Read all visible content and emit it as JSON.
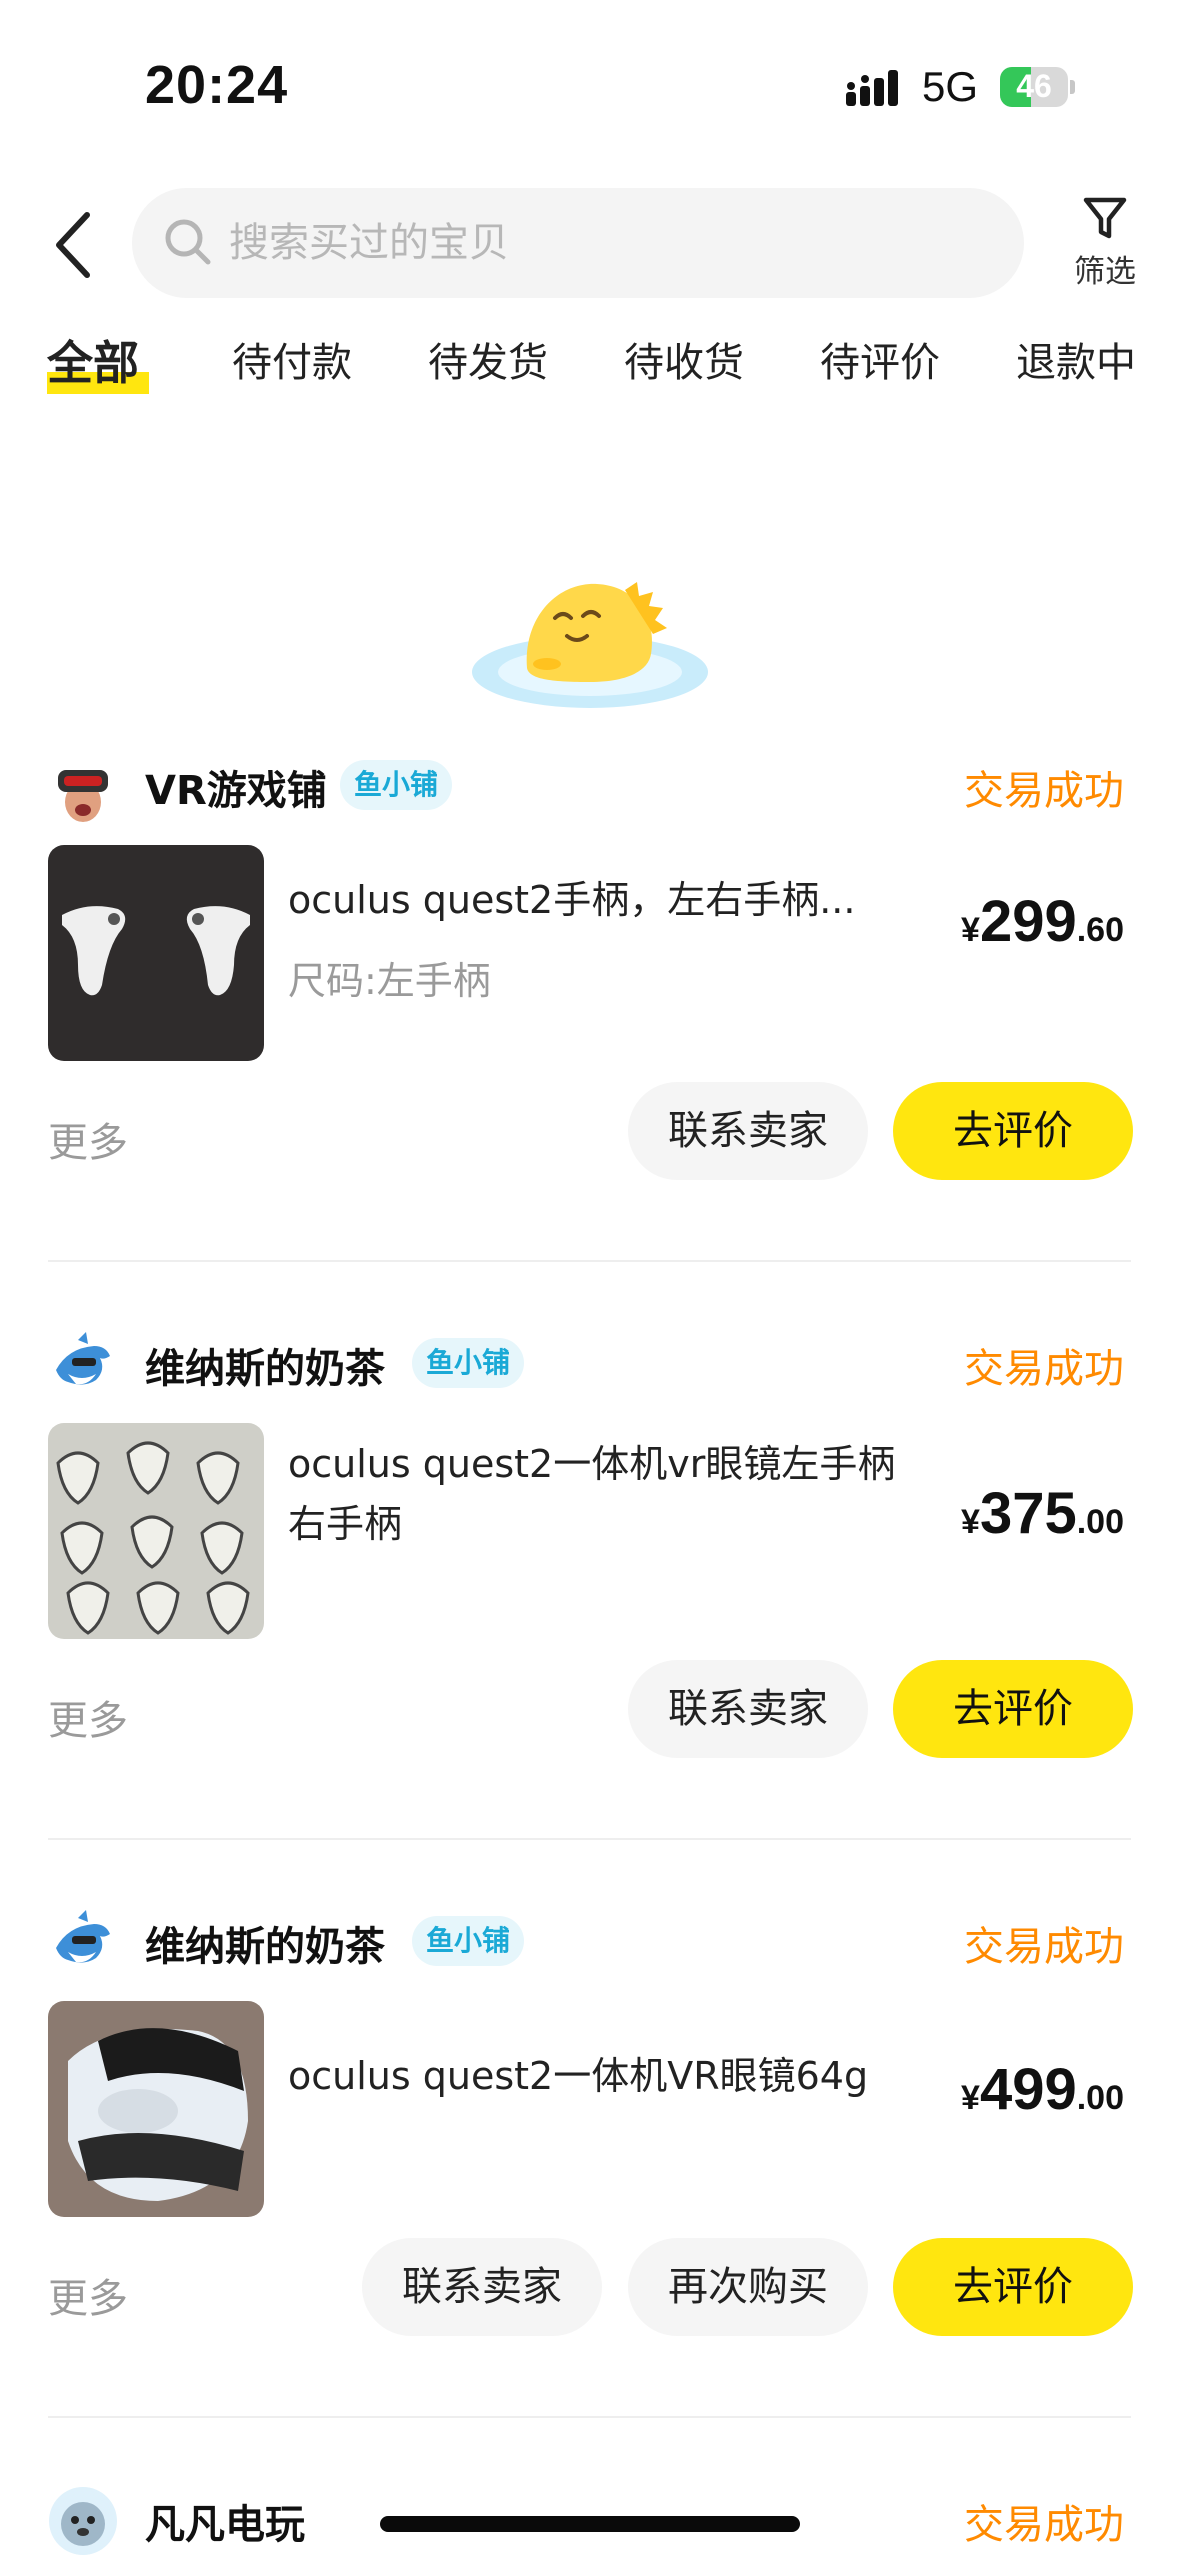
{
  "status_bar": {
    "time": "20:24",
    "network": "5G",
    "battery_level": "46",
    "battery_percent": 46
  },
  "search": {
    "placeholder": "搜索买过的宝贝",
    "filter_label": "筛选"
  },
  "tabs": [
    {
      "label": "全部",
      "active": true
    },
    {
      "label": "待付款",
      "active": false
    },
    {
      "label": "待发货",
      "active": false
    },
    {
      "label": "待收货",
      "active": false
    },
    {
      "label": "待评价",
      "active": false
    },
    {
      "label": "退款中",
      "active": false
    }
  ],
  "colors": {
    "accent_yellow": "#ffe60f",
    "status_orange": "#ff8a00",
    "badge_blue": "#1aa9d6",
    "battery_green": "#34c759"
  },
  "orders": [
    {
      "shop_name": "VR游戏铺",
      "shop_badge": "鱼小铺",
      "status": "交易成功",
      "product_title": "oculus quest2手柄，左右手柄...",
      "product_spec": "尺码:左手柄",
      "price_currency": "¥",
      "price_integer": "299",
      "price_decimal": ".60",
      "more_label": "更多",
      "contact_label": "联系卖家",
      "review_label": "去评价"
    },
    {
      "shop_name": "维纳斯的奶茶",
      "shop_badge": "鱼小铺",
      "status": "交易成功",
      "product_title": "oculus quest2一体机vr眼镜左手柄右手柄",
      "price_currency": "¥",
      "price_integer": "375",
      "price_decimal": ".00",
      "more_label": "更多",
      "contact_label": "联系卖家",
      "review_label": "去评价"
    },
    {
      "shop_name": "维纳斯的奶茶",
      "shop_badge": "鱼小铺",
      "status": "交易成功",
      "product_title": "oculus quest2一体机VR眼镜64g",
      "price_currency": "¥",
      "price_integer": "499",
      "price_decimal": ".00",
      "more_label": "更多",
      "contact_label": "联系卖家",
      "rebuy_label": "再次购买",
      "review_label": "去评价"
    },
    {
      "shop_name": "凡凡电玩",
      "status": "交易成功"
    }
  ]
}
